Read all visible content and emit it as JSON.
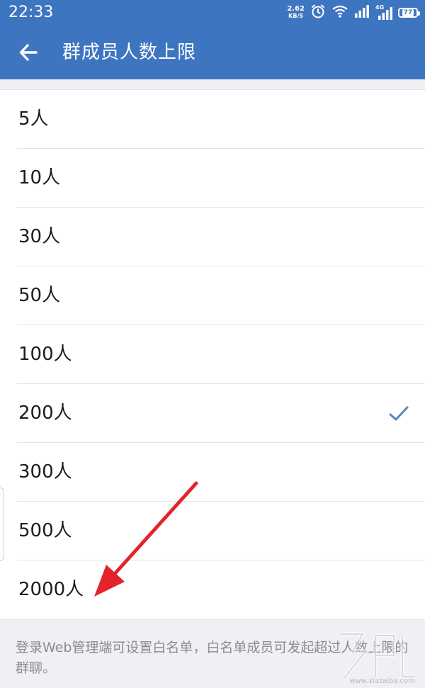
{
  "status_bar": {
    "time": "22:33",
    "net_speed_value": "2.62",
    "net_speed_unit": "KB/S",
    "network_type": "4G",
    "battery": "77",
    "icons": [
      "alarm-icon",
      "wifi-icon",
      "signal-icon",
      "signal-4g-icon",
      "battery-icon"
    ]
  },
  "app_bar": {
    "back_icon": "arrow-left-icon",
    "title": "群成员人数上限"
  },
  "options": [
    {
      "label": "5人",
      "selected": false
    },
    {
      "label": "10人",
      "selected": false
    },
    {
      "label": "30人",
      "selected": false
    },
    {
      "label": "50人",
      "selected": false
    },
    {
      "label": "100人",
      "selected": false
    },
    {
      "label": "200人",
      "selected": true
    },
    {
      "label": "300人",
      "selected": false
    },
    {
      "label": "500人",
      "selected": false
    },
    {
      "label": "2000人",
      "selected": false
    }
  ],
  "footer_note": "登录Web管理端可设置白名单，白名单成员可发起超过人数上限的群聊。",
  "watermark": {
    "url": "www.xiazaiba.com"
  },
  "colors": {
    "primary": "#3e75c0",
    "check": "#5a84b9",
    "annotation_arrow": "#e3252b"
  }
}
